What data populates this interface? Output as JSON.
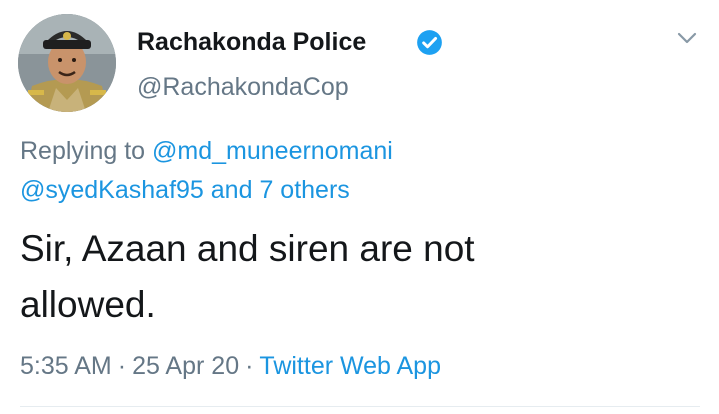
{
  "author": {
    "name": "Rachakonda Police",
    "handle": "@RachakondaCop",
    "verified": true,
    "verified_color": "#1da1f2"
  },
  "reply": {
    "prefix": "Replying to",
    "mention_primary": "@md_muneernomani",
    "mention_secondary": "@syedKashaf95",
    "and_label": "and",
    "others_label": "7 others"
  },
  "tweet": {
    "text_line1": "Sir, Azaan and siren are not",
    "text_line2": "allowed."
  },
  "meta": {
    "time": "5:35 AM",
    "separator": "·",
    "date": "25 Apr 20",
    "source": "Twitter Web App"
  },
  "icons": {
    "menu": "chevron-down-icon",
    "verified": "verified-badge-icon"
  },
  "colors": {
    "link": "#1b95e0",
    "secondary_text": "#657786",
    "primary_text": "#14171a"
  }
}
